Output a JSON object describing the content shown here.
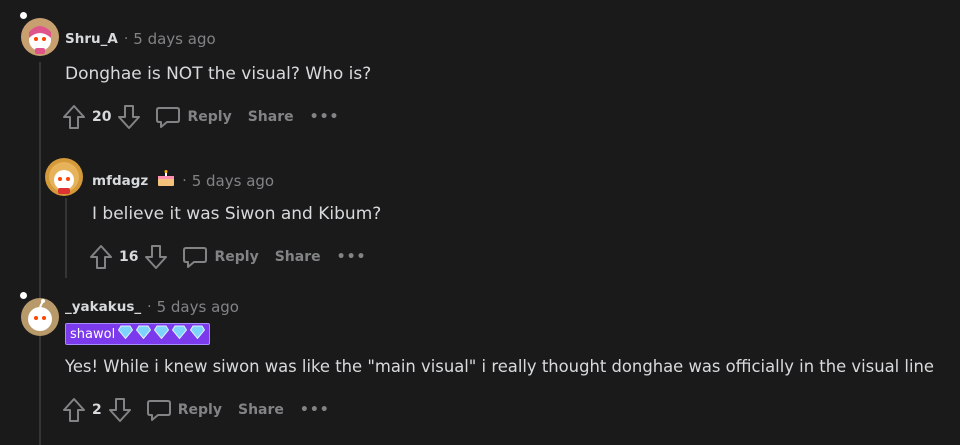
{
  "colors": {
    "background": "#1a1a1b",
    "text": "#d7dadc",
    "muted": "#818384",
    "thread_line": "#343536",
    "flair_bg": "#7c3aed"
  },
  "comments": [
    {
      "username": "Shru_A",
      "separator": "·",
      "time": "5 days ago",
      "body": "Donghae is NOT the visual? Who is?",
      "score": "20",
      "reply_label": "Reply",
      "share_label": "Share",
      "more_label": "•••",
      "avatar_icon": "snoo-avatar-pink-hair"
    },
    {
      "username": "mfdagz",
      "separator": "·",
      "time": "5 days ago",
      "body": "I believe it was Siwon and Kibum?",
      "score": "16",
      "reply_label": "Reply",
      "share_label": "Share",
      "more_label": "•••",
      "avatar_icon": "snoo-avatar-lion",
      "award_icon": "cake-icon"
    },
    {
      "username": "_yakakus_",
      "separator": "·",
      "time": "5 days ago",
      "flair_text": "shawol",
      "flair_icons": [
        "diamond-icon",
        "diamond-icon",
        "diamond-icon",
        "diamond-icon",
        "diamond-icon"
      ],
      "body": "Yes! While i knew siwon was like the \"main visual\" i really thought donghae was officially in the visual line",
      "score": "2",
      "reply_label": "Reply",
      "share_label": "Share",
      "more_label": "•••",
      "avatar_icon": "snoo-avatar-default"
    }
  ]
}
